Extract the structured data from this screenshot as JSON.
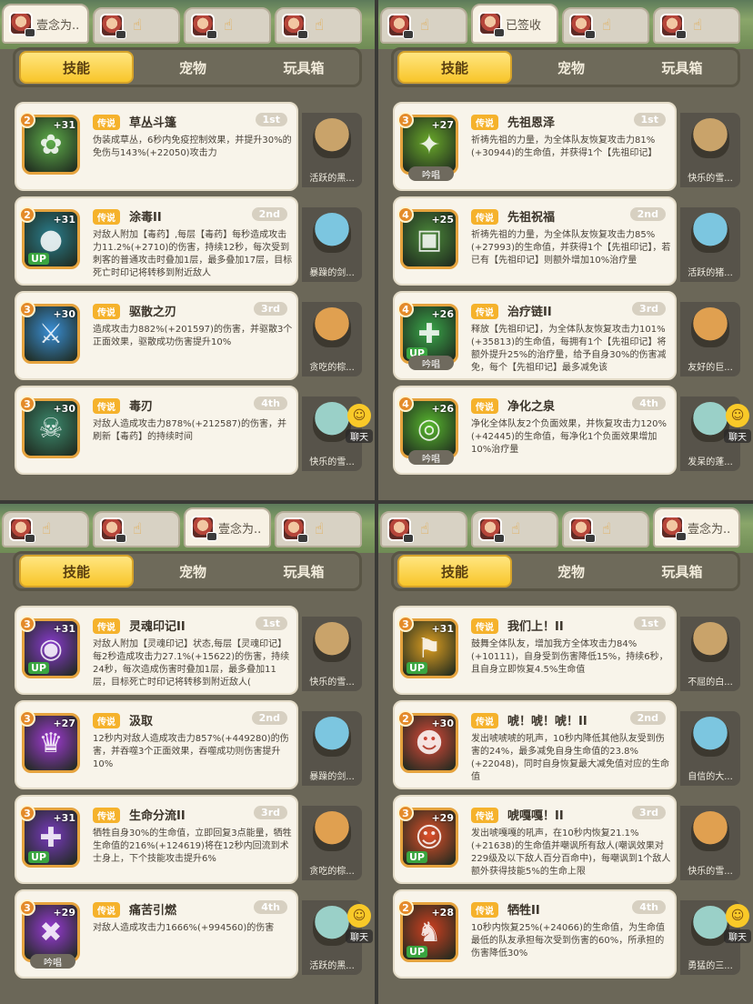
{
  "panels": [
    {
      "player_tabs": [
        {
          "name": "壹念为..",
          "active": true
        },
        {
          "name": "",
          "active": false
        },
        {
          "name": "",
          "active": false
        },
        {
          "name": "",
          "active": false
        }
      ],
      "segments": [
        "技能",
        "宠物",
        "玩具箱"
      ],
      "active_segment": 0,
      "skills": [
        {
          "level": "2",
          "plus": "+31",
          "badge": "传说",
          "name": "草丛斗篷",
          "rank": "1st",
          "desc": "伪装成草丛，6秒内免疫控制效果，并提升30%的免伤与143%(+22050)攻击力",
          "pet_name": "活跃的黑...",
          "icon_color": "#5fae4a",
          "glyph": "✿",
          "up": false,
          "chant": ""
        },
        {
          "level": "2",
          "plus": "+31",
          "badge": "传说",
          "name": "涂毒II",
          "rank": "2nd",
          "desc": "对敌人附加【毒药】,每层【毒药】每秒造成攻击力11.2%(+2710)的伤害，持续12秒，每次受到刺客的普通攻击时叠加1层，最多叠加17层，目标死亡时印记将转移到附近敌人",
          "pet_name": "暴躁的剑...",
          "icon_color": "#2a7f8f",
          "glyph": "●",
          "up": true,
          "chant": ""
        },
        {
          "level": "3",
          "plus": "+30",
          "badge": "传说",
          "name": "驱散之刃",
          "rank": "3rd",
          "desc": "造成攻击力882%(+201597)的伤害，并驱散3个正面效果，驱散成功伤害提升10%",
          "pet_name": "贪吃的棕...",
          "icon_color": "#3a8fd6",
          "glyph": "⚔",
          "up": false,
          "chant": ""
        },
        {
          "level": "3",
          "plus": "+30",
          "badge": "传说",
          "name": "毒刃",
          "rank": "4th",
          "desc": "对敌人造成攻击力878%(+212587)的伤害，并刷新【毒药】的持续时间",
          "pet_name": "快乐的雪...",
          "icon_color": "#3c8a6e",
          "glyph": "☠",
          "up": false,
          "chant": ""
        }
      ],
      "chat_label": "聊天"
    },
    {
      "player_tabs": [
        {
          "name": "",
          "active": false
        },
        {
          "name": "已签收",
          "active": true
        },
        {
          "name": "",
          "active": false
        },
        {
          "name": "",
          "active": false
        }
      ],
      "segments": [
        "技能",
        "宠物",
        "玩具箱"
      ],
      "active_segment": 0,
      "skills": [
        {
          "level": "3",
          "plus": "+27",
          "badge": "传说",
          "name": "先祖恩泽",
          "rank": "1st",
          "desc": "祈祷先祖的力量，为全体队友恢复攻击力81%(+30944)的生命值，并获得1个【先祖印记】",
          "pet_name": "快乐的雪...",
          "icon_color": "#6aaa2a",
          "glyph": "✦",
          "up": false,
          "chant": "吟唱"
        },
        {
          "level": "4",
          "plus": "+25",
          "badge": "传说",
          "name": "先祖祝福",
          "rank": "2nd",
          "desc": "祈祷先祖的力量，为全体队友恢复攻击力85%(+27993)的生命值，并获得1个【先祖印记】，若已有【先祖印记】则额外增加10%治疗量",
          "pet_name": "活跃的猪...",
          "icon_color": "#4c8a3a",
          "glyph": "▣",
          "up": false,
          "chant": ""
        },
        {
          "level": "4",
          "plus": "+26",
          "badge": "传说",
          "name": "治疗链II",
          "rank": "3rd",
          "desc": "释放【先祖印记】，为全体队友恢复攻击力101%(+35813)的生命值，每拥有1个【先祖印记】将额外提升25%的治疗量，给予自身30%的伤害减免，每个【先祖印记】最多减免该",
          "pet_name": "友好的巨...",
          "icon_color": "#3aa84a",
          "glyph": "✚",
          "up": true,
          "chant": "吟唱"
        },
        {
          "level": "4",
          "plus": "+26",
          "badge": "传说",
          "name": "净化之泉",
          "rank": "4th",
          "desc": "净化全体队友2个负面效果，并恢复攻击力120%(+42445)的生命值，每净化1个负面效果增加10%治疗量",
          "pet_name": "发呆的蓬...",
          "icon_color": "#58b82e",
          "glyph": "◎",
          "up": false,
          "chant": "吟唱"
        }
      ],
      "chat_label": "聊天"
    },
    {
      "player_tabs": [
        {
          "name": "",
          "active": false
        },
        {
          "name": "",
          "active": false
        },
        {
          "name": "壹念为..",
          "active": true
        },
        {
          "name": "",
          "active": false
        }
      ],
      "segments": [
        "技能",
        "宠物",
        "玩具箱"
      ],
      "active_segment": 0,
      "skills": [
        {
          "level": "3",
          "plus": "+31",
          "badge": "传说",
          "name": "灵魂印记II",
          "rank": "1st",
          "desc": "对敌人附加【灵魂印记】状态,每层【灵魂印记】每2秒造成攻击力27.1%(+15622)的伤害，持续24秒，每次造成伤害时叠加1层，最多叠加11层，目标死亡时印记将转移到附近敌人(",
          "pet_name": "快乐的雪...",
          "icon_color": "#8a3ad0",
          "glyph": "◉",
          "up": true,
          "chant": ""
        },
        {
          "level": "3",
          "plus": "+27",
          "badge": "传说",
          "name": "汲取",
          "rank": "2nd",
          "desc": "12秒内对敌人造成攻击力857%(+449280)的伤害，并吞噬3个正面效果，吞噬成功则伤害提升10%",
          "pet_name": "暴躁的剑...",
          "icon_color": "#a23ad6",
          "glyph": "♛",
          "up": false,
          "chant": ""
        },
        {
          "level": "3",
          "plus": "+31",
          "badge": "传说",
          "name": "生命分流II",
          "rank": "3rd",
          "desc": "牺牲自身30%的生命值，立即回复3点能量，牺牲生命值的216%(+124619)将在12秒内回流到术士身上，下个技能攻击提升6%",
          "pet_name": "贪吃的棕...",
          "icon_color": "#7a3ac0",
          "glyph": "✚",
          "up": true,
          "chant": ""
        },
        {
          "level": "3",
          "plus": "+29",
          "badge": "传说",
          "name": "痛苦引燃",
          "rank": "4th",
          "desc": "对敌人造成攻击力1666%(+994560)的伤害",
          "pet_name": "活跃的黑...",
          "icon_color": "#9a3ad8",
          "glyph": "✖",
          "up": false,
          "chant": "吟唱"
        }
      ],
      "chat_label": "聊天"
    },
    {
      "player_tabs": [
        {
          "name": "",
          "active": false
        },
        {
          "name": "",
          "active": false
        },
        {
          "name": "",
          "active": false
        },
        {
          "name": "壹念为..",
          "active": true
        }
      ],
      "segments": [
        "技能",
        "宠物",
        "玩具箱"
      ],
      "active_segment": 0,
      "skills": [
        {
          "level": "3",
          "plus": "+31",
          "badge": "传说",
          "name": "我们上！II",
          "rank": "1st",
          "desc": "鼓舞全体队友，增加我方全体攻击力84%(+10111)，自身受到伤害降低15%，持续6秒，且自身立即恢复4.5%生命值",
          "pet_name": "不屈的白...",
          "icon_color": "#e0a020",
          "glyph": "⚑",
          "up": true,
          "chant": ""
        },
        {
          "level": "2",
          "plus": "+30",
          "badge": "传说",
          "name": "唬！唬！唬！II",
          "rank": "2nd",
          "desc": "发出唬唬唬的吼声，10秒内降低其他队友受到伤害的24%，最多减免自身生命值的23.8%(+22048)，同时自身恢复最大减免值对应的生命值",
          "pet_name": "自信的大...",
          "icon_color": "#e04a3a",
          "glyph": "☻",
          "up": false,
          "chant": ""
        },
        {
          "level": "3",
          "plus": "+29",
          "badge": "传说",
          "name": "唬嘎嘎！II",
          "rank": "3rd",
          "desc": "发出唬嘎嘎的吼声，在10秒内恢复21.1%(+21638)的生命值并嘲讽所有敌人(嘲讽效果对229级及以下敌人百分百命中)，每嘲讽到1个敌人额外获得技能5%的生命上限",
          "pet_name": "快乐的雪...",
          "icon_color": "#e0502a",
          "glyph": "☺",
          "up": true,
          "chant": ""
        },
        {
          "level": "2",
          "plus": "+28",
          "badge": "传说",
          "name": "牺牲II",
          "rank": "4th",
          "desc": "10秒内恢复25%(+24066)的生命值，为生命值最低的队友承担每次受到伤害的60%，所承担的伤害降低30%",
          "pet_name": "勇猛的三...",
          "icon_color": "#d04020",
          "glyph": "♞",
          "up": true,
          "chant": ""
        }
      ],
      "chat_label": "聊天"
    }
  ]
}
